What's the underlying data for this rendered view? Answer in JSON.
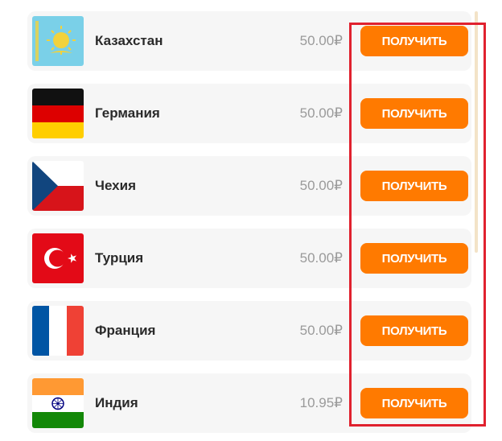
{
  "countries": [
    {
      "name": "Казахстан",
      "price": "50.00₽",
      "button": "ПОЛУЧИТЬ"
    },
    {
      "name": "Германия",
      "price": "50.00₽",
      "button": "ПОЛУЧИТЬ"
    },
    {
      "name": "Чехия",
      "price": "50.00₽",
      "button": "ПОЛУЧИТЬ"
    },
    {
      "name": "Турция",
      "price": "50.00₽",
      "button": "ПОЛУЧИТЬ"
    },
    {
      "name": "Франция",
      "price": "50.00₽",
      "button": "ПОЛУЧИТЬ"
    },
    {
      "name": "Индия",
      "price": "10.95₽",
      "button": "ПОЛУЧИТЬ"
    }
  ],
  "colors": {
    "button": "#ff7a00",
    "highlight_box": "#e0212e",
    "row_background": "#f6f6f6"
  },
  "icons": [
    "kazakhstan-flag-icon",
    "germany-flag-icon",
    "czechia-flag-icon",
    "turkey-flag-icon",
    "france-flag-icon",
    "india-flag-icon"
  ]
}
